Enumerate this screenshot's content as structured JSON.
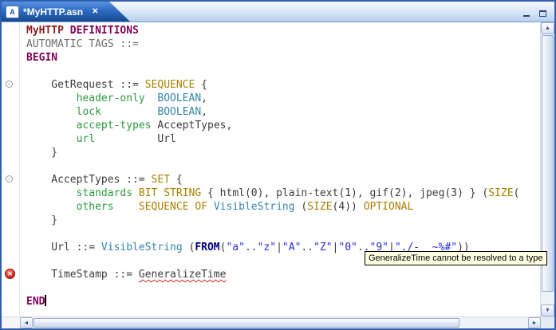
{
  "window": {
    "tab": {
      "title": "*MyHTTP.asn",
      "close_glyph": "✕",
      "icon_letter": "A"
    }
  },
  "palette": {
    "module": "#8b1c1c",
    "keyword": "#7f0055",
    "type_keyword": "#a98000",
    "builtin_type": "#3584ad",
    "field": "#2b9a3e",
    "string": "#2a2ad9",
    "from_keyword": "#00007f",
    "plain": "#3c3c3c",
    "gray": "#6e6e6e",
    "error_underline": "#cc2222",
    "tooltip_bg": "#ffffe1",
    "window_border": "#2f5fae",
    "tab_top": "#5a93e0",
    "tab_bottom": "#14498f"
  },
  "gutter": {
    "fold_marker_lines": [
      5,
      12
    ],
    "fold_glyph": "-",
    "error_marker_line": 19,
    "error_marker_glyph": "✕"
  },
  "scrollbar": {
    "up_glyph": "▲",
    "down_glyph": "▼",
    "left_glyph": "◄",
    "right_glyph": "►"
  },
  "tooltip": {
    "text": "GeneralizeTime cannot be resolved to a type"
  },
  "code": {
    "lines": [
      [
        {
          "c": "module",
          "t": "MyHTTP"
        },
        {
          "c": "plain",
          "t": " "
        },
        {
          "c": "kw",
          "t": "DEFINITIONS"
        }
      ],
      [
        {
          "c": "gray",
          "t": "AUTOMATIC TAGS ::="
        }
      ],
      [
        {
          "c": "kw",
          "t": "BEGIN"
        }
      ],
      [],
      [
        {
          "c": "plain",
          "t": "    GetRequest ::= "
        },
        {
          "c": "tkw",
          "t": "SEQUENCE"
        },
        {
          "c": "plain",
          "t": " {"
        }
      ],
      [
        {
          "c": "plain",
          "t": "        "
        },
        {
          "c": "field",
          "t": "header-only"
        },
        {
          "c": "plain",
          "t": "  "
        },
        {
          "c": "builtin",
          "t": "BOOLEAN"
        },
        {
          "c": "plain",
          "t": ","
        }
      ],
      [
        {
          "c": "plain",
          "t": "        "
        },
        {
          "c": "field",
          "t": "lock"
        },
        {
          "c": "plain",
          "t": "         "
        },
        {
          "c": "builtin",
          "t": "BOOLEAN"
        },
        {
          "c": "plain",
          "t": ","
        }
      ],
      [
        {
          "c": "plain",
          "t": "        "
        },
        {
          "c": "field",
          "t": "accept-types"
        },
        {
          "c": "plain",
          "t": " AcceptTypes,"
        }
      ],
      [
        {
          "c": "plain",
          "t": "        "
        },
        {
          "c": "field",
          "t": "url"
        },
        {
          "c": "plain",
          "t": "          Url"
        }
      ],
      [
        {
          "c": "plain",
          "t": "    }"
        }
      ],
      [],
      [
        {
          "c": "plain",
          "t": "    AcceptTypes ::= "
        },
        {
          "c": "tkw",
          "t": "SET"
        },
        {
          "c": "plain",
          "t": " {"
        }
      ],
      [
        {
          "c": "plain",
          "t": "        "
        },
        {
          "c": "field",
          "t": "standards"
        },
        {
          "c": "plain",
          "t": " "
        },
        {
          "c": "tkw",
          "t": "BIT STRING"
        },
        {
          "c": "plain",
          "t": " { html(0), plain-text(1), gif(2), jpeg(3) } ("
        },
        {
          "c": "tkw",
          "t": "SIZE"
        },
        {
          "c": "plain",
          "t": "("
        }
      ],
      [
        {
          "c": "plain",
          "t": "        "
        },
        {
          "c": "field",
          "t": "others"
        },
        {
          "c": "plain",
          "t": "    "
        },
        {
          "c": "tkw",
          "t": "SEQUENCE OF"
        },
        {
          "c": "plain",
          "t": " "
        },
        {
          "c": "builtin",
          "t": "VisibleString"
        },
        {
          "c": "plain",
          "t": " ("
        },
        {
          "c": "tkw",
          "t": "SIZE"
        },
        {
          "c": "plain",
          "t": "(4)) "
        },
        {
          "c": "tkw",
          "t": "OPTIONAL"
        }
      ],
      [
        {
          "c": "plain",
          "t": "    }"
        }
      ],
      [],
      [
        {
          "c": "plain",
          "t": "    Url ::= "
        },
        {
          "c": "builtin",
          "t": "VisibleString"
        },
        {
          "c": "plain",
          "t": " ("
        },
        {
          "c": "from",
          "t": "FROM"
        },
        {
          "c": "plain",
          "t": "("
        },
        {
          "c": "str",
          "t": "\"a\""
        },
        {
          "c": "plain",
          "t": ".."
        },
        {
          "c": "str",
          "t": "\"z\""
        },
        {
          "c": "plain",
          "t": "|"
        },
        {
          "c": "str",
          "t": "\"A\""
        },
        {
          "c": "plain",
          "t": ".."
        },
        {
          "c": "str",
          "t": "\"Z\""
        },
        {
          "c": "plain",
          "t": "|"
        },
        {
          "c": "str",
          "t": "\"0\""
        },
        {
          "c": "plain",
          "t": ".."
        },
        {
          "c": "str",
          "t": "\"9\""
        },
        {
          "c": "plain",
          "t": "|"
        },
        {
          "c": "str",
          "t": "\"./-_ ~%#\""
        },
        {
          "c": "plain",
          "t": "))"
        }
      ],
      [],
      [
        {
          "c": "plain",
          "t": "    TimeStamp ::= "
        },
        {
          "c": "err",
          "t": "GeneralizeTime"
        }
      ],
      [],
      [
        {
          "c": "kw",
          "t": "END"
        },
        {
          "c": "caret",
          "t": ""
        }
      ]
    ]
  }
}
